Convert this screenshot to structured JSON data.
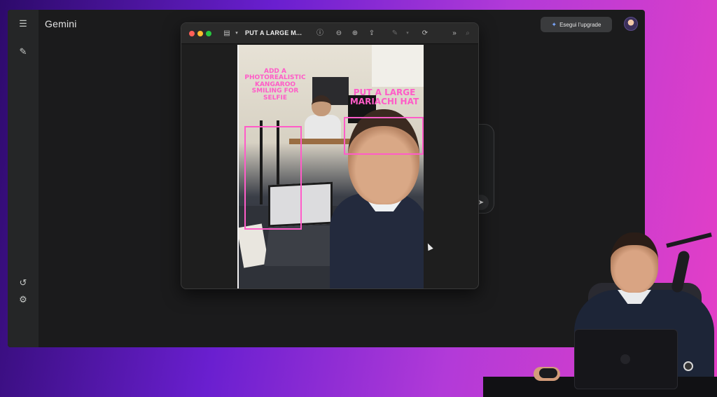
{
  "gemini": {
    "title": "Gemini",
    "upgrade_label": "Esegui l'upgrade",
    "sidebar_icons": [
      "menu-icon",
      "edit-icon",
      "history-icon",
      "settings-icon"
    ],
    "send_icon": "send-icon"
  },
  "preview": {
    "title": "PUT A LARGE M...",
    "toolbar_icons": [
      "sidebar-toggle-icon",
      "info-icon",
      "zoom-out-icon",
      "zoom-in-icon",
      "share-icon",
      "markup-pen-icon",
      "rotate-icon",
      "more-icon",
      "search-icon"
    ]
  },
  "photo": {
    "annotation_left": "ADD A PHOTOREALISTIC KANGAROO SMILING FOR SELFIE",
    "annotation_right": "PUT A LARGE MARIACHI HAT",
    "annotation_color": "#ff5cc8"
  },
  "colors": {
    "background_gradient_start": "#2d0a6b",
    "background_gradient_end": "#e53fc6",
    "gemini_bg": "#1b1b1c",
    "sidebar_bg": "#252627"
  }
}
